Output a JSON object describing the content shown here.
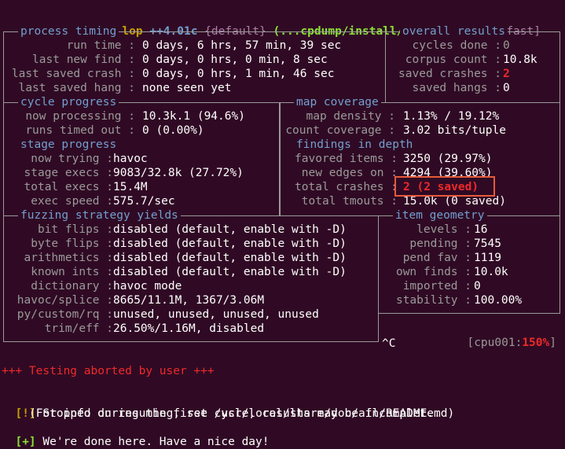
{
  "banner": {
    "app": "american fuzzy lop",
    "version": "++4.01c",
    "mode": "{default}",
    "path": "(...cpdump/install/sbin/tcpdump)",
    "schedule": "[fast]"
  },
  "process_timing": {
    "title": "process timing",
    "rows": [
      {
        "label": "run time :",
        "value": "0 days, 6 hrs, 57 min, 39 sec"
      },
      {
        "label": "last new find :",
        "value": "0 days, 0 hrs, 0 min, 8 sec"
      },
      {
        "label": "last saved crash :",
        "value": "0 days, 0 hrs, 1 min, 46 sec"
      },
      {
        "label": "last saved hang :",
        "value": "none seen yet"
      }
    ]
  },
  "overall_results": {
    "title": "overall results",
    "rows": [
      {
        "label": "cycles done :",
        "value": "0"
      },
      {
        "label": "corpus count :",
        "value": "10.8k"
      },
      {
        "label": "saved crashes :",
        "value": "2"
      },
      {
        "label": "saved hangs :",
        "value": "0"
      }
    ]
  },
  "cycle_progress": {
    "title": "cycle progress",
    "rows": [
      {
        "label": "now processing :",
        "value": "10.3k.1 (94.6%)"
      },
      {
        "label": "runs timed out :",
        "value": "0 (0.00%)"
      }
    ]
  },
  "map_coverage": {
    "title": "map coverage",
    "rows": [
      {
        "label": "map density :",
        "value": "1.13% / 19.12%"
      },
      {
        "label": "count coverage :",
        "value": "3.02 bits/tuple"
      }
    ]
  },
  "stage_progress": {
    "title": "stage progress",
    "rows": [
      {
        "label": "now trying :",
        "value": "havoc"
      },
      {
        "label": "stage execs :",
        "value": "9083/32.8k (27.72%)"
      },
      {
        "label": "total execs :",
        "value": "15.4M"
      },
      {
        "label": "exec speed :",
        "value": "575.7/sec"
      }
    ]
  },
  "findings": {
    "title": "findings in depth",
    "rows": [
      {
        "label": "favored items :",
        "value": "3250 (29.97%)"
      },
      {
        "label": "new edges on :",
        "value": "4294 (39.60%)"
      },
      {
        "label": "total crashes :",
        "value": "2 (2 saved)"
      },
      {
        "label": "total tmouts :",
        "value": "15.0k (0 saved)"
      }
    ]
  },
  "strategy": {
    "title": "fuzzing strategy yields",
    "rows": [
      {
        "label": "bit flips :",
        "value": "disabled (default, enable with -D)"
      },
      {
        "label": "byte flips :",
        "value": "disabled (default, enable with -D)"
      },
      {
        "label": "arithmetics :",
        "value": "disabled (default, enable with -D)"
      },
      {
        "label": "known ints :",
        "value": "disabled (default, enable with -D)"
      },
      {
        "label": "dictionary :",
        "value": "havoc mode"
      },
      {
        "label": "havoc/splice :",
        "value": "8665/11.1M, 1367/3.06M"
      },
      {
        "label": "py/custom/rq :",
        "value": "unused, unused, unused, unused"
      },
      {
        "label": "trim/eff :",
        "value": "26.50%/1.16M, disabled"
      }
    ]
  },
  "item_geometry": {
    "title": "item geometry",
    "rows": [
      {
        "label": "levels :",
        "value": "16"
      },
      {
        "label": "pending :",
        "value": "7545"
      },
      {
        "label": "pend fav :",
        "value": "1119"
      },
      {
        "label": "own finds :",
        "value": "10.0k"
      },
      {
        "label": "imported :",
        "value": "0"
      },
      {
        "label": "stability :",
        "value": "100.00%"
      }
    ]
  },
  "cpu": {
    "prefix": "[cpu001:",
    "value": "150%",
    "suffix": "]"
  },
  "interrupt": "^C",
  "footer": {
    "aborted": "+++ Testing aborted by user +++",
    "warn_tag": "[!]",
    "warn_text": "Stopped during the first cycle, results may be incomplete.",
    "info_text": "(For info on resuming, see /usr/local/share/doc/afl/README.md)",
    "done_tag": "[+]",
    "done_text": "We're done here. Have a nice day!"
  },
  "colors": {
    "background": "#300a24",
    "frame": "#9a9a9a",
    "section_title": "#729fcf",
    "alert": "#ef2929",
    "highlight_box": "#e65a3a"
  }
}
